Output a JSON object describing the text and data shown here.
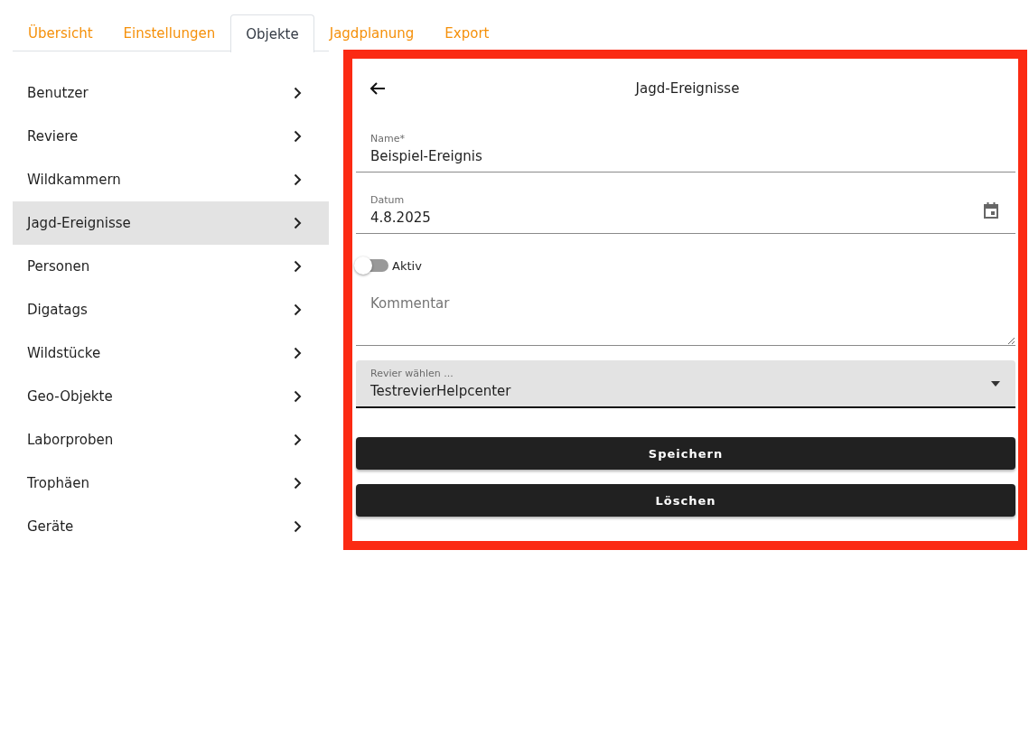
{
  "tabs": [
    {
      "label": "Übersicht",
      "selected": false
    },
    {
      "label": "Einstellungen",
      "selected": false
    },
    {
      "label": "Objekte",
      "selected": true
    },
    {
      "label": "Jagdplanung",
      "selected": false
    },
    {
      "label": "Export",
      "selected": false
    }
  ],
  "sidebar": {
    "items": [
      {
        "label": "Benutzer",
        "selected": false
      },
      {
        "label": "Reviere",
        "selected": false
      },
      {
        "label": "Wildkammern",
        "selected": false
      },
      {
        "label": "Jagd-Ereignisse",
        "selected": true
      },
      {
        "label": "Personen",
        "selected": false
      },
      {
        "label": "Digatags",
        "selected": false
      },
      {
        "label": "Wildstücke",
        "selected": false
      },
      {
        "label": "Geo-Objekte",
        "selected": false
      },
      {
        "label": "Laborproben",
        "selected": false
      },
      {
        "label": "Trophäen",
        "selected": false
      },
      {
        "label": "Geräte",
        "selected": false
      }
    ]
  },
  "form": {
    "title": "Jagd-Ereignisse",
    "name_field": {
      "label": "Name*",
      "value": "Beispiel-Ereignis"
    },
    "date_field": {
      "label": "Datum",
      "value": "4.8.2025"
    },
    "active_toggle": {
      "label": "Aktiv",
      "on": false
    },
    "comment_field": {
      "placeholder": "Kommentar"
    },
    "area_select": {
      "label": "Revier wählen ...",
      "value": "TestrevierHelpcenter"
    },
    "buttons": [
      "Speichern",
      "Löschen"
    ]
  }
}
